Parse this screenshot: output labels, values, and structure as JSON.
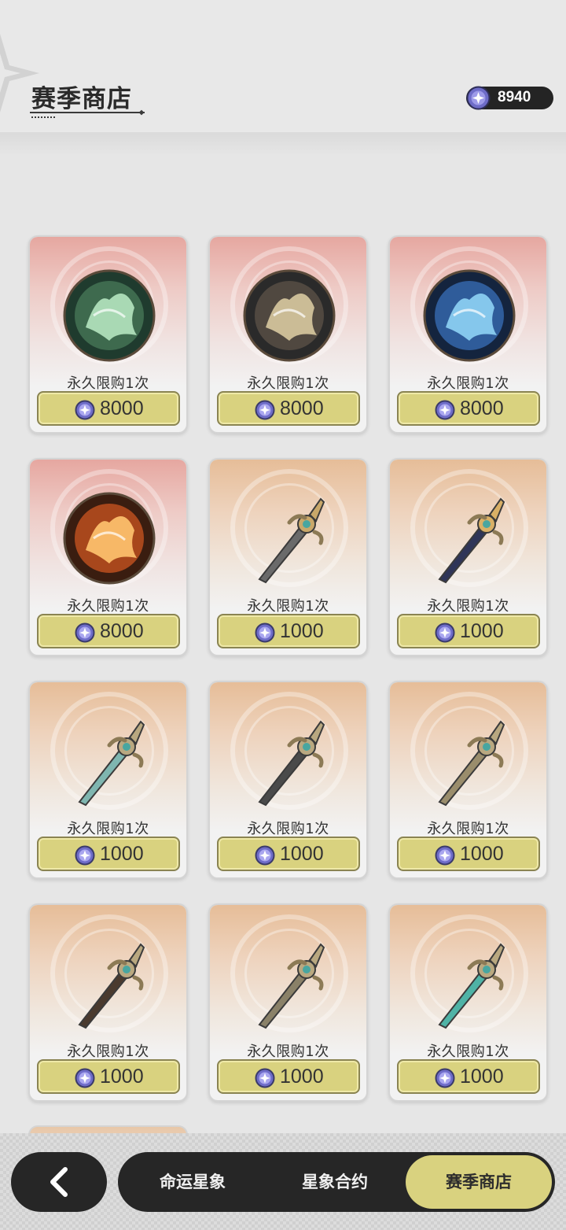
{
  "header": {
    "title": "赛季商店",
    "currency_icon": "star-gem-icon",
    "currency_amount": "8940"
  },
  "shop": {
    "items": [
      {
        "art": "thunder-dragon-emblem",
        "limit": "永久限购1次",
        "price": "8000",
        "rarity": "red"
      },
      {
        "art": "shadow-lion-emblem",
        "limit": "永久限购1次",
        "price": "8000",
        "rarity": "red"
      },
      {
        "art": "ice-wolf-emblem",
        "limit": "永久限购1次",
        "price": "8000",
        "rarity": "red"
      },
      {
        "art": "fire-phoenix-emblem",
        "limit": "永久限购1次",
        "price": "8000",
        "rarity": "red"
      },
      {
        "art": "cloud-sword-weapon",
        "limit": "永久限购1次",
        "price": "1000",
        "rarity": "gold"
      },
      {
        "art": "sun-staff-weapon",
        "limit": "永久限购1次",
        "price": "1000",
        "rarity": "gold"
      },
      {
        "art": "cloud-greatsword-weapon",
        "limit": "永久限购1次",
        "price": "1000",
        "rarity": "gold"
      },
      {
        "art": "wheel-polearm-weapon",
        "limit": "永久限购1次",
        "price": "1000",
        "rarity": "gold"
      },
      {
        "art": "cloud-bow-weapon",
        "limit": "永久限购1次",
        "price": "1000",
        "rarity": "gold"
      },
      {
        "art": "cloud-gauntlet-weapon",
        "limit": "永久限购1次",
        "price": "1000",
        "rarity": "gold"
      },
      {
        "art": "cloud-tome-weapon",
        "limit": "永久限购1次",
        "price": "1000",
        "rarity": "gold"
      },
      {
        "art": "dragon-orb-catalyst",
        "limit": "永久限购1次",
        "price": "1000",
        "rarity": "gold"
      }
    ]
  },
  "nav": {
    "back_icon": "chevron-left-icon",
    "tabs": [
      "命运星象",
      "星象合约",
      "赛季商店"
    ],
    "active_tab": "赛季商店"
  },
  "colors": {
    "accent": "#d9d27f",
    "dark": "#262626",
    "rare_bg": "#e6a7a0",
    "common_bg": "#e6bd98"
  }
}
